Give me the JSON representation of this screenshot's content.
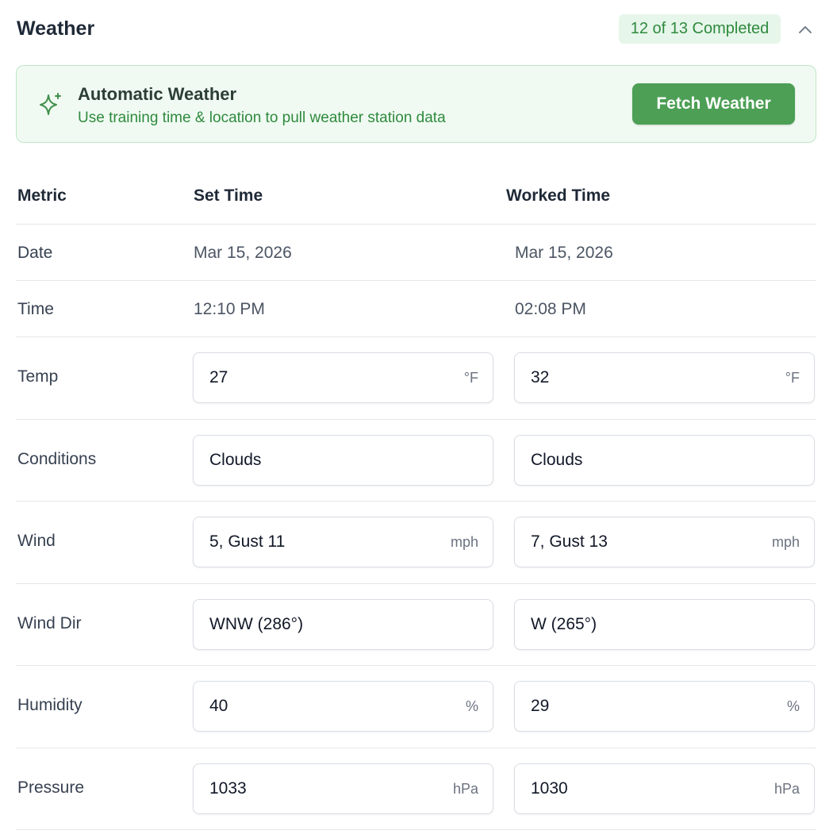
{
  "section": {
    "title": "Weather",
    "progress_badge": "12 of 13 Completed",
    "collapse_icon": "chevron-up-icon"
  },
  "banner": {
    "icon": "sparkle-icon",
    "title": "Automatic Weather",
    "subtitle": "Use training time & location to pull weather station data",
    "button_label": "Fetch Weather"
  },
  "colors": {
    "accent": "#4c9f55",
    "badge_bg": "#e6f6ea",
    "badge_text": "#2f8a3e",
    "banner_bg": "#f0faf2"
  },
  "table": {
    "headers": [
      "Metric",
      "Set Time",
      "Worked Time"
    ],
    "rows": [
      {
        "label": "Date",
        "set": "Mar 15, 2026",
        "worked": "Mar 15, 2026"
      },
      {
        "label": "Time",
        "set": "12:10 PM",
        "worked": "02:08 PM"
      },
      {
        "label": "Temp",
        "set": "27",
        "worked": "32",
        "unit": "°F"
      },
      {
        "label": "Conditions",
        "set": "Clouds",
        "worked": "Clouds",
        "unit": ""
      },
      {
        "label": "Wind",
        "set": "5, Gust 11",
        "worked": "7, Gust 13",
        "unit": "mph"
      },
      {
        "label": "Wind Dir",
        "set": "WNW (286°)",
        "worked": "W (265°)",
        "unit": ""
      },
      {
        "label": "Humidity",
        "set": "40",
        "worked": "29",
        "unit": "%"
      },
      {
        "label": "Pressure",
        "set": "1033",
        "worked": "1030",
        "unit": "hPa"
      }
    ]
  }
}
